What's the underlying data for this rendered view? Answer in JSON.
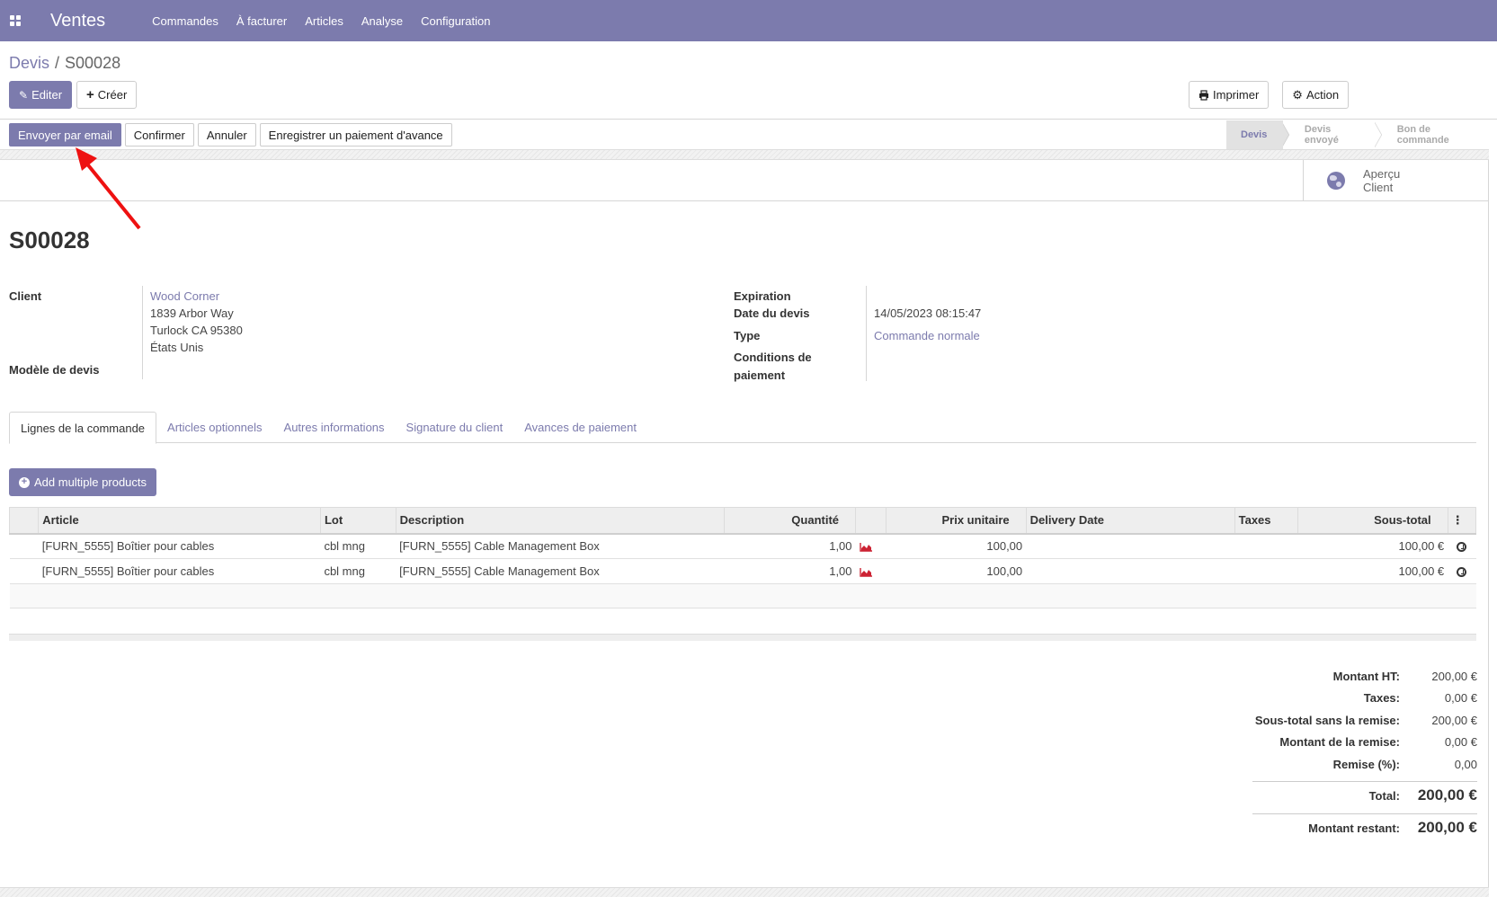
{
  "app": {
    "title": "Ventes",
    "menu": [
      "Commandes",
      "À facturer",
      "Articles",
      "Analyse",
      "Configuration"
    ]
  },
  "breadcrumb": {
    "parent": "Devis",
    "sep": "/",
    "current": "S00028"
  },
  "control_panel": {
    "edit": "Editer",
    "create": "Créer",
    "print": "Imprimer",
    "action": "Action"
  },
  "actions": [
    "Envoyer par email",
    "Confirmer",
    "Annuler",
    "Enregistrer un paiement d'avance"
  ],
  "stages": [
    "Devis",
    "Devis envoyé",
    "Bon de commande"
  ],
  "smart_button": {
    "line1": "Aperçu",
    "line2": "Client"
  },
  "record": {
    "name": "S00028",
    "client_label": "Client",
    "client_name": "Wood Corner",
    "address": [
      "1839 Arbor Way",
      "Turlock CA 95380",
      "États Unis"
    ],
    "template_label": "Modèle de devis",
    "expiration_label": "Expiration",
    "date_label": "Date du devis",
    "date_value": "14/05/2023 08:15:47",
    "type_label": "Type",
    "type_value": "Commande normale",
    "payment_label_1": "Conditions de",
    "payment_label_2": "paiement"
  },
  "tabs": [
    "Lignes de la commande",
    "Articles optionnels",
    "Autres informations",
    "Signature du client",
    "Avances de paiement"
  ],
  "add_products": "Add multiple products",
  "table": {
    "headers": {
      "article": "Article",
      "lot": "Lot",
      "description": "Description",
      "quantity": "Quantité",
      "unit_price": "Prix unitaire",
      "delivery": "Delivery Date",
      "taxes": "Taxes",
      "subtotal": "Sous-total"
    },
    "rows": [
      {
        "article": "[FURN_5555] Boîtier pour cables",
        "lot": "cbl mng",
        "description": "[FURN_5555] Cable Management Box",
        "quantity": "1,00",
        "unit_price": "100,00",
        "delivery": "",
        "taxes": "",
        "subtotal": "100,00 €"
      },
      {
        "article": "[FURN_5555] Boîtier pour cables",
        "lot": "cbl mng",
        "description": "[FURN_5555] Cable Management Box",
        "quantity": "1,00",
        "unit_price": "100,00",
        "delivery": "",
        "taxes": "",
        "subtotal": "100,00 €"
      }
    ]
  },
  "totals": [
    {
      "label": "Montant HT:",
      "value": "200,00 €"
    },
    {
      "label": "Taxes:",
      "value": "0,00 €"
    },
    {
      "label": "Sous-total sans la remise:",
      "value": "200,00 €"
    },
    {
      "label": "Montant de la remise:",
      "value": "0,00 €"
    },
    {
      "label": "Remise (%):",
      "value": "0,00"
    },
    {
      "label": "Total:",
      "value": "200,00 €"
    },
    {
      "label": "Montant restant:",
      "value": "200,00 €"
    }
  ],
  "colors": {
    "brand": "#7c7bad",
    "annotation_arrow": "#ee1111",
    "chart_icon": "#cc2233"
  }
}
